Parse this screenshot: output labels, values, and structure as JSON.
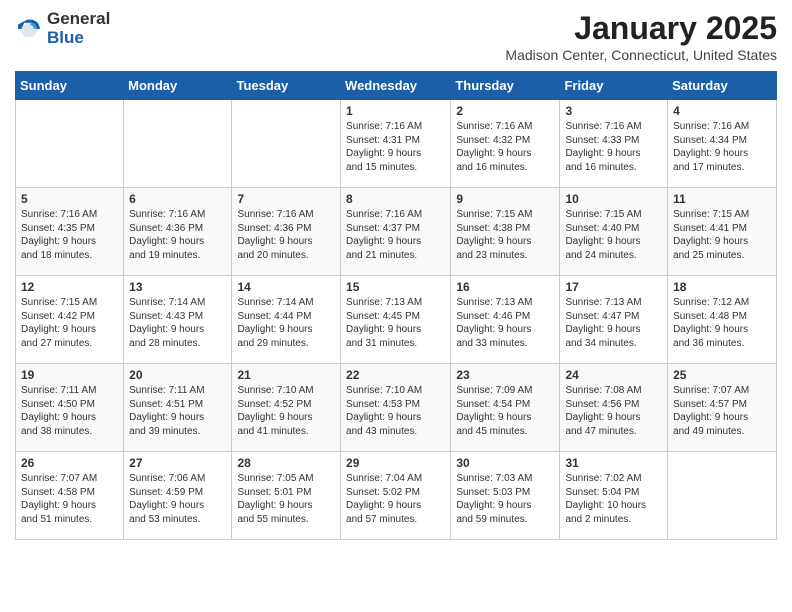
{
  "header": {
    "logo_general": "General",
    "logo_blue": "Blue",
    "month_year": "January 2025",
    "location": "Madison Center, Connecticut, United States"
  },
  "weekdays": [
    "Sunday",
    "Monday",
    "Tuesday",
    "Wednesday",
    "Thursday",
    "Friday",
    "Saturday"
  ],
  "weeks": [
    [
      {
        "day": "",
        "info": ""
      },
      {
        "day": "",
        "info": ""
      },
      {
        "day": "",
        "info": ""
      },
      {
        "day": "1",
        "info": "Sunrise: 7:16 AM\nSunset: 4:31 PM\nDaylight: 9 hours\nand 15 minutes."
      },
      {
        "day": "2",
        "info": "Sunrise: 7:16 AM\nSunset: 4:32 PM\nDaylight: 9 hours\nand 16 minutes."
      },
      {
        "day": "3",
        "info": "Sunrise: 7:16 AM\nSunset: 4:33 PM\nDaylight: 9 hours\nand 16 minutes."
      },
      {
        "day": "4",
        "info": "Sunrise: 7:16 AM\nSunset: 4:34 PM\nDaylight: 9 hours\nand 17 minutes."
      }
    ],
    [
      {
        "day": "5",
        "info": "Sunrise: 7:16 AM\nSunset: 4:35 PM\nDaylight: 9 hours\nand 18 minutes."
      },
      {
        "day": "6",
        "info": "Sunrise: 7:16 AM\nSunset: 4:36 PM\nDaylight: 9 hours\nand 19 minutes."
      },
      {
        "day": "7",
        "info": "Sunrise: 7:16 AM\nSunset: 4:36 PM\nDaylight: 9 hours\nand 20 minutes."
      },
      {
        "day": "8",
        "info": "Sunrise: 7:16 AM\nSunset: 4:37 PM\nDaylight: 9 hours\nand 21 minutes."
      },
      {
        "day": "9",
        "info": "Sunrise: 7:15 AM\nSunset: 4:38 PM\nDaylight: 9 hours\nand 23 minutes."
      },
      {
        "day": "10",
        "info": "Sunrise: 7:15 AM\nSunset: 4:40 PM\nDaylight: 9 hours\nand 24 minutes."
      },
      {
        "day": "11",
        "info": "Sunrise: 7:15 AM\nSunset: 4:41 PM\nDaylight: 9 hours\nand 25 minutes."
      }
    ],
    [
      {
        "day": "12",
        "info": "Sunrise: 7:15 AM\nSunset: 4:42 PM\nDaylight: 9 hours\nand 27 minutes."
      },
      {
        "day": "13",
        "info": "Sunrise: 7:14 AM\nSunset: 4:43 PM\nDaylight: 9 hours\nand 28 minutes."
      },
      {
        "day": "14",
        "info": "Sunrise: 7:14 AM\nSunset: 4:44 PM\nDaylight: 9 hours\nand 29 minutes."
      },
      {
        "day": "15",
        "info": "Sunrise: 7:13 AM\nSunset: 4:45 PM\nDaylight: 9 hours\nand 31 minutes."
      },
      {
        "day": "16",
        "info": "Sunrise: 7:13 AM\nSunset: 4:46 PM\nDaylight: 9 hours\nand 33 minutes."
      },
      {
        "day": "17",
        "info": "Sunrise: 7:13 AM\nSunset: 4:47 PM\nDaylight: 9 hours\nand 34 minutes."
      },
      {
        "day": "18",
        "info": "Sunrise: 7:12 AM\nSunset: 4:48 PM\nDaylight: 9 hours\nand 36 minutes."
      }
    ],
    [
      {
        "day": "19",
        "info": "Sunrise: 7:11 AM\nSunset: 4:50 PM\nDaylight: 9 hours\nand 38 minutes."
      },
      {
        "day": "20",
        "info": "Sunrise: 7:11 AM\nSunset: 4:51 PM\nDaylight: 9 hours\nand 39 minutes."
      },
      {
        "day": "21",
        "info": "Sunrise: 7:10 AM\nSunset: 4:52 PM\nDaylight: 9 hours\nand 41 minutes."
      },
      {
        "day": "22",
        "info": "Sunrise: 7:10 AM\nSunset: 4:53 PM\nDaylight: 9 hours\nand 43 minutes."
      },
      {
        "day": "23",
        "info": "Sunrise: 7:09 AM\nSunset: 4:54 PM\nDaylight: 9 hours\nand 45 minutes."
      },
      {
        "day": "24",
        "info": "Sunrise: 7:08 AM\nSunset: 4:56 PM\nDaylight: 9 hours\nand 47 minutes."
      },
      {
        "day": "25",
        "info": "Sunrise: 7:07 AM\nSunset: 4:57 PM\nDaylight: 9 hours\nand 49 minutes."
      }
    ],
    [
      {
        "day": "26",
        "info": "Sunrise: 7:07 AM\nSunset: 4:58 PM\nDaylight: 9 hours\nand 51 minutes."
      },
      {
        "day": "27",
        "info": "Sunrise: 7:06 AM\nSunset: 4:59 PM\nDaylight: 9 hours\nand 53 minutes."
      },
      {
        "day": "28",
        "info": "Sunrise: 7:05 AM\nSunset: 5:01 PM\nDaylight: 9 hours\nand 55 minutes."
      },
      {
        "day": "29",
        "info": "Sunrise: 7:04 AM\nSunset: 5:02 PM\nDaylight: 9 hours\nand 57 minutes."
      },
      {
        "day": "30",
        "info": "Sunrise: 7:03 AM\nSunset: 5:03 PM\nDaylight: 9 hours\nand 59 minutes."
      },
      {
        "day": "31",
        "info": "Sunrise: 7:02 AM\nSunset: 5:04 PM\nDaylight: 10 hours\nand 2 minutes."
      },
      {
        "day": "",
        "info": ""
      }
    ]
  ]
}
